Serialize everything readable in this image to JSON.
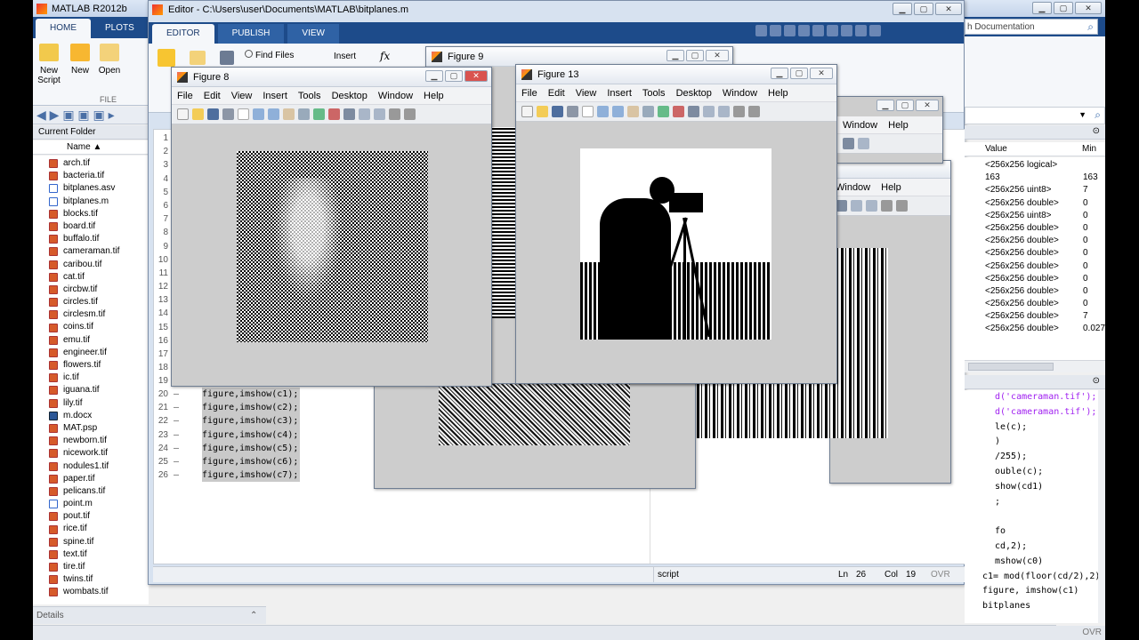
{
  "app": {
    "title": "MATLAB R2012b"
  },
  "main_ribbon": {
    "tabs": [
      "HOME",
      "PLOTS"
    ],
    "new_script": "New\nScript",
    "new": "New",
    "open": "Open",
    "section_file": "FILE"
  },
  "current_folder": {
    "header": "Current Folder",
    "column_name": "Name ▲",
    "files": [
      {
        "name": "arch.tif",
        "type": "tif"
      },
      {
        "name": "bacteria.tif",
        "type": "tif"
      },
      {
        "name": "bitplanes.asv",
        "type": "m"
      },
      {
        "name": "bitplanes.m",
        "type": "m"
      },
      {
        "name": "blocks.tif",
        "type": "tif"
      },
      {
        "name": "board.tif",
        "type": "tif"
      },
      {
        "name": "buffalo.tif",
        "type": "tif"
      },
      {
        "name": "cameraman.tif",
        "type": "tif"
      },
      {
        "name": "caribou.tif",
        "type": "tif"
      },
      {
        "name": "cat.tif",
        "type": "tif"
      },
      {
        "name": "circbw.tif",
        "type": "tif"
      },
      {
        "name": "circles.tif",
        "type": "tif"
      },
      {
        "name": "circlesm.tif",
        "type": "tif"
      },
      {
        "name": "coins.tif",
        "type": "tif"
      },
      {
        "name": "emu.tif",
        "type": "tif"
      },
      {
        "name": "engineer.tif",
        "type": "tif"
      },
      {
        "name": "flowers.tif",
        "type": "tif"
      },
      {
        "name": "ic.tif",
        "type": "tif"
      },
      {
        "name": "iguana.tif",
        "type": "tif"
      },
      {
        "name": "lily.tif",
        "type": "tif"
      },
      {
        "name": "m.docx",
        "type": "d"
      },
      {
        "name": "MAT.psp",
        "type": "tif"
      },
      {
        "name": "newborn.tif",
        "type": "tif"
      },
      {
        "name": "nicework.tif",
        "type": "tif"
      },
      {
        "name": "nodules1.tif",
        "type": "tif"
      },
      {
        "name": "paper.tif",
        "type": "tif"
      },
      {
        "name": "pelicans.tif",
        "type": "tif"
      },
      {
        "name": "point.m",
        "type": "m"
      },
      {
        "name": "pout.tif",
        "type": "tif"
      },
      {
        "name": "rice.tif",
        "type": "tif"
      },
      {
        "name": "spine.tif",
        "type": "tif"
      },
      {
        "name": "text.tif",
        "type": "tif"
      },
      {
        "name": "tire.tif",
        "type": "tif"
      },
      {
        "name": "twins.tif",
        "type": "tif"
      },
      {
        "name": "wombats.tif",
        "type": "tif"
      }
    ],
    "details": "Details"
  },
  "editor": {
    "title": "Editor - C:\\Users\\user\\Documents\\MATLAB\\bitplanes.m",
    "tabs": [
      "EDITOR",
      "PUBLISH",
      "VIEW"
    ],
    "find_files": "Find Files",
    "insert": "Insert",
    "fx": "fx",
    "line_numbers": [
      "1",
      "2",
      "3",
      "4",
      "5",
      "6",
      "7",
      "8",
      "9",
      "10",
      "11",
      "12",
      "13",
      "14",
      "15",
      "16",
      "17",
      "18",
      "19"
    ],
    "visible_code": [
      {
        "n": "20",
        "code": "figure,imshow(c1);"
      },
      {
        "n": "21",
        "code": "figure,imshow(c2);"
      },
      {
        "n": "22",
        "code": "figure,imshow(c3);"
      },
      {
        "n": "23",
        "code": "figure,imshow(c4);"
      },
      {
        "n": "24",
        "code": "figure,imshow(c5);"
      },
      {
        "n": "25",
        "code": "figure,imshow(c6);"
      },
      {
        "n": "26",
        "code": "figure,imshow(c7);"
      }
    ],
    "status": {
      "mode": "script",
      "ln_label": "Ln",
      "ln": "26",
      "col_label": "Col",
      "col": "19",
      "ovr": "OVR"
    }
  },
  "search": {
    "placeholder": "h Documentation"
  },
  "workspace": {
    "col_value": "Value",
    "col_min": "Min",
    "rows": [
      {
        "value": "<256x256 logical>",
        "min": ""
      },
      {
        "value": "163",
        "min": "163"
      },
      {
        "value": "<256x256 uint8>",
        "min": "7"
      },
      {
        "value": "<256x256 double>",
        "min": "0"
      },
      {
        "value": "<256x256 uint8>",
        "min": "0"
      },
      {
        "value": "<256x256 double>",
        "min": "0"
      },
      {
        "value": "<256x256 double>",
        "min": "0"
      },
      {
        "value": "<256x256 double>",
        "min": "0"
      },
      {
        "value": "<256x256 double>",
        "min": "0"
      },
      {
        "value": "<256x256 double>",
        "min": "0"
      },
      {
        "value": "<256x256 double>",
        "min": "0"
      },
      {
        "value": "<256x256 double>",
        "min": "0"
      },
      {
        "value": "<256x256 double>",
        "min": "7"
      },
      {
        "value": "<256x256 double>",
        "min": "0.0275"
      }
    ]
  },
  "history": {
    "lines": [
      "d('cameraman.tif');",
      "d('cameraman.tif');",
      "le(c);",
      ")",
      "/255);",
      "ouble(c);",
      "show(cd1)",
      ";",
      "",
      "fo",
      "cd,2);",
      "mshow(c0)",
      "c1= mod(floor(cd/2),2);",
      "figure, imshow(c1)",
      "bitplanes"
    ]
  },
  "status_ovr": "OVR",
  "figures": {
    "fig8": {
      "title": "Figure 8"
    },
    "fig9": {
      "title": "Figure 9"
    },
    "fig13": {
      "title": "Figure 13"
    },
    "menu": [
      "File",
      "Edit",
      "View",
      "Insert",
      "Tools",
      "Desktop",
      "Window",
      "Help"
    ],
    "partial_menu": [
      "Window",
      "Help"
    ]
  }
}
